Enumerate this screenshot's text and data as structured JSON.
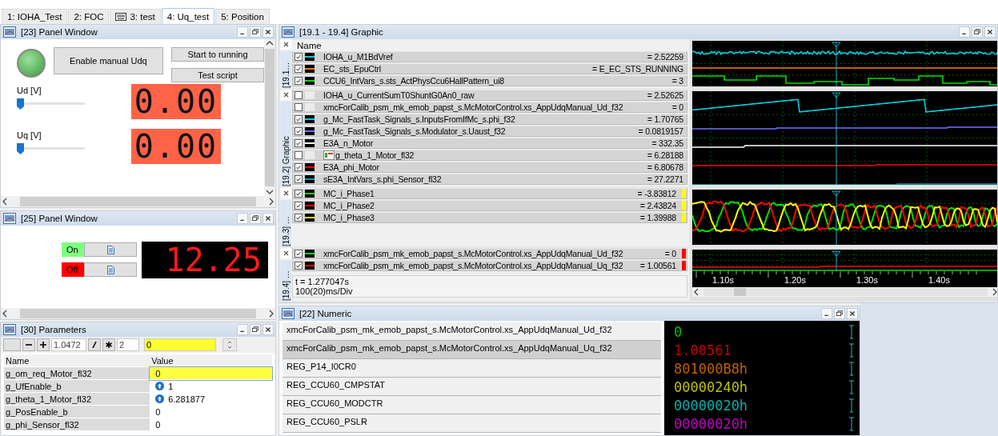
{
  "tabs": [
    {
      "label": "1: IOHA_Test",
      "selected": false
    },
    {
      "label": "2: FOC",
      "selected": false
    },
    {
      "label": "3: test",
      "selected": false,
      "icon": true
    },
    {
      "label": "4: Uq_test",
      "selected": true
    },
    {
      "label": "5: Position",
      "selected": false
    }
  ],
  "panel_23": {
    "title": "[23] Panel Window",
    "lamp_on": true,
    "main_button": "Enable manual Udq",
    "buttons": [
      "Start to running",
      "Test script"
    ],
    "sliders": [
      {
        "label": "Ud [V]",
        "level": 0,
        "display": "0.00"
      },
      {
        "label": "Uq [V]",
        "level": 0,
        "display": "0.00"
      }
    ]
  },
  "panel_25": {
    "title": "[25] Panel Window",
    "switches": [
      {
        "label": "On",
        "color": "#80ff80"
      },
      {
        "label": "Off",
        "color": "#ff0000"
      }
    ],
    "display": "12.25"
  },
  "parameters": {
    "title": "[30] Parameters",
    "step": "1.0472",
    "factor": "2",
    "edit_value": "0",
    "columns": [
      "Name",
      "Value"
    ],
    "rows": [
      {
        "name": "g_om_req_Motor_fl32",
        "value": "0",
        "selected": true,
        "icon": false
      },
      {
        "name": "g_UfEnable_b",
        "value": "1",
        "selected": false,
        "icon": true
      },
      {
        "name": "g_theta_1_Motor_fl32",
        "value": "6.281877",
        "selected": false,
        "icon": true
      },
      {
        "name": "g_PosEnable_b",
        "value": "0",
        "selected": false,
        "icon": false
      },
      {
        "name": "g_phi_Sensor_fl32",
        "value": "0",
        "selected": false,
        "icon": false
      }
    ]
  },
  "graphic": {
    "title": "[19.1 - 19.4] Graphic",
    "name_header": "Name",
    "time": "t = 1.277047s",
    "scale": "100(20)ms/Div",
    "xticks": [
      "1.10s",
      "1.20s",
      "1.30s",
      "1.40s"
    ],
    "groups": [
      {
        "label": "[19.1…",
        "rows": [
          {
            "name": "IOHA_u_M1BdVref",
            "value": "= 2.52259",
            "checked": true,
            "color": "#00d0e0"
          },
          {
            "name": "EC_sts_EpuCtrl",
            "value": "= E_EC_STS_RUNNING",
            "checked": true,
            "color": "#ff8000"
          },
          {
            "name": "CCU6_IntVars_s.sts_ActPhysCcu6HallPattern_ui8",
            "value": "= 3",
            "checked": true,
            "color": "#00e000"
          }
        ]
      },
      {
        "label": "[19.2] Graphic",
        "rows": [
          {
            "name": "IOHA_u_CurrentSumT0ShuntG0An0_raw",
            "value": "= 2.52625",
            "checked": false
          },
          {
            "name": "xmcForCalib_psm_mk_emob_papst_s.McMotorControl.xs_AppUdqManual_Ud_f32",
            "value": "= 0",
            "checked": false
          },
          {
            "name": "g_Mc_FastTask_Signals_s.InputsFromIfMc_s.phi_f32",
            "value": "= 1.70765",
            "checked": true,
            "color": "#00d0e0"
          },
          {
            "name": "g_Mc_FastTask_Signals_s.Modulator_s.Uaust_f32",
            "value": "= 0.0819157",
            "checked": true,
            "color": "#7070ff"
          },
          {
            "name": "E3A_n_Motor",
            "value": "= 332.35",
            "checked": true,
            "color": "#ffffff"
          },
          {
            "name": "g_theta_1_Motor_fl32",
            "value": "= 6.28188",
            "checked": false,
            "image_icon": true
          },
          {
            "name": "E3A_phi_Motor",
            "value": "= 6.80678",
            "checked": true,
            "color": "#ff0000"
          },
          {
            "name": "sE3A_IntVars_s.phi_Sensor_fl32",
            "value": "= 27.2271",
            "checked": true,
            "color": "#00a0b0"
          }
        ]
      },
      {
        "label": "[19.3] …",
        "color": "#ffff00",
        "rows": [
          {
            "name": "MC_i_Phase1",
            "value": "= -3.83812",
            "checked": true,
            "color": "#00e000"
          },
          {
            "name": "MC_i_Phase2",
            "value": "= 2.43824",
            "checked": true,
            "color": "#ff0000"
          },
          {
            "name": "MC_i_Phase3",
            "value": "= 1.39988",
            "checked": true,
            "color": "#ffff00"
          }
        ]
      },
      {
        "label": "[19.4] …",
        "color": "#ff0000",
        "rows": [
          {
            "name": "xmcForCalib_psm_mk_emob_papst_s.McMotorControl.xs_AppUdqManual_Ud_f32",
            "value": "= 0",
            "checked": true,
            "color": "#00e000"
          },
          {
            "name": "xmcForCalib_psm_mk_emob_papst_s.McMotorControl.xs_AppUdqManual_Uq_f32",
            "value": "= 1.00561",
            "checked": true,
            "color": "#ff0000"
          }
        ]
      }
    ]
  },
  "numeric": {
    "title": "[22] Numeric",
    "rows": [
      {
        "name": "xmcForCalib_psm_mk_emob_papst_s.McMotorControl.xs_AppUdqManual_Ud_f32",
        "value": "0",
        "color": "#00c000",
        "selected": false
      },
      {
        "name": "xmcForCalib_psm_mk_emob_papst_s.McMotorControl.xs_AppUdqManual_Uq_f32",
        "value": "1.00561",
        "color": "#c00000",
        "selected": true
      },
      {
        "name": "REG_P14_I0CR0",
        "value": "801000B8h",
        "color": "#c06000",
        "selected": false
      },
      {
        "name": "REG_CCU60_CMPSTAT",
        "value": "00000240h",
        "color": "#c0c000",
        "selected": false
      },
      {
        "name": "REG_CCU60_MODCTR",
        "value": "00000020h",
        "color": "#00b0b0",
        "selected": false
      },
      {
        "name": "REG_CCU60_PSLR",
        "value": "00000020h",
        "color": "#c000c0",
        "selected": false
      }
    ]
  }
}
